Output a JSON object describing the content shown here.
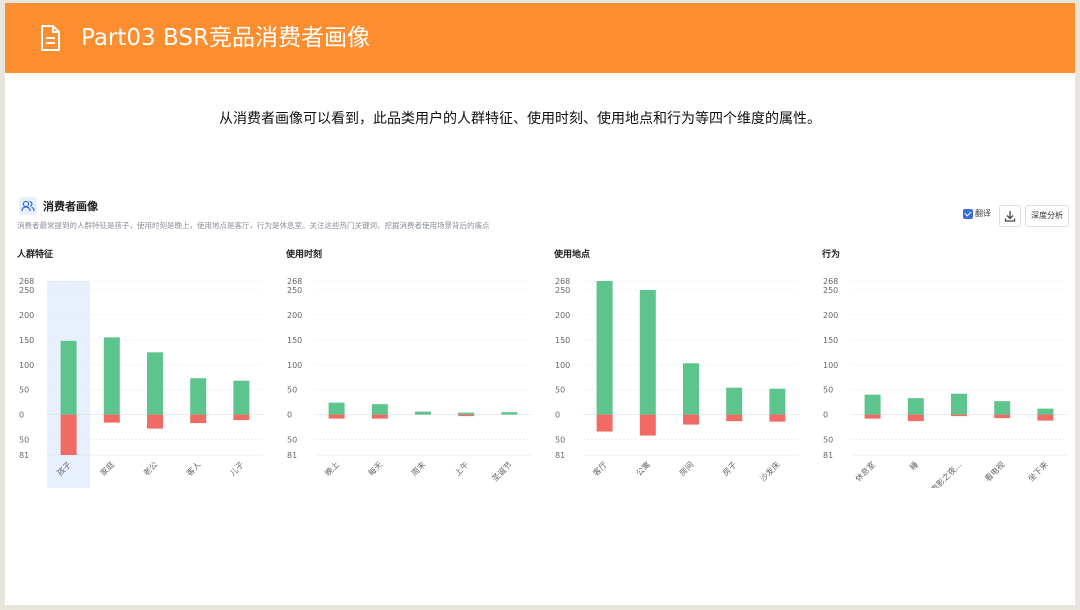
{
  "header": {
    "title": "Part03 BSR竞品消费者画像",
    "icon": "document-icon",
    "bg_color": "#fd8e2f"
  },
  "subtitle": "从消费者画像可以看到，此品类用户的人群特征、使用时刻、使用地点和行为等四个维度的属性。",
  "card": {
    "title": "消费者画像",
    "description": "消费者最常提到的人群特征是孩子，使用时刻是晚上，使用地点是客厅，行为是休息室。关注这些热门关键词，挖掘消费者使用场景背后的痛点",
    "toolbar": {
      "translate_label": "翻译",
      "translate_checked": true,
      "download_icon": "download-icon",
      "deep_analysis_label": "深度分析"
    }
  },
  "colors": {
    "positive": "#5ec48e",
    "negative": "#f06b63",
    "highlight": "#e8f0fd",
    "grid": "#e9ecf1",
    "axis_text": "#666666"
  },
  "chart_data": [
    {
      "type": "bar",
      "title": "人群特征",
      "categories": [
        "孩子",
        "家庭",
        "老公",
        "客人",
        "儿子"
      ],
      "series": [
        {
          "values": [
            148,
            155,
            125,
            73,
            68
          ]
        },
        {
          "values": [
            -81,
            -16,
            -28,
            -17,
            -11
          ]
        }
      ],
      "ylim": [
        -81,
        268
      ],
      "yticks_pos": [
        "268",
        "250",
        "200",
        "150",
        "100",
        "50",
        "0"
      ],
      "yticks_neg": [
        "50",
        "81"
      ],
      "highlighted_category": "孩子"
    },
    {
      "type": "bar",
      "title": "使用时刻",
      "categories": [
        "晚上",
        "每天",
        "周末",
        "上午",
        "圣诞节"
      ],
      "series": [
        {
          "values": [
            24,
            21,
            6,
            4,
            5
          ]
        },
        {
          "values": [
            -8,
            -8,
            0,
            -3,
            0
          ]
        }
      ],
      "ylim": [
        -81,
        268
      ],
      "yticks_pos": [
        "268",
        "250",
        "200",
        "150",
        "100",
        "50",
        "0"
      ],
      "yticks_neg": [
        "50",
        "81"
      ]
    },
    {
      "type": "bar",
      "title": "使用地点",
      "categories": [
        "客厅",
        "公寓",
        "房间",
        "房子",
        "沙发床"
      ],
      "series": [
        {
          "values": [
            268,
            250,
            103,
            54,
            52
          ]
        },
        {
          "values": [
            -34,
            -42,
            -20,
            -13,
            -14
          ]
        }
      ],
      "ylim": [
        -81,
        268
      ],
      "yticks_pos": [
        "268",
        "250",
        "200",
        "150",
        "100",
        "50",
        "0"
      ],
      "yticks_neg": [
        "50",
        "81"
      ]
    },
    {
      "type": "bar",
      "title": "行为",
      "categories": [
        "休息室",
        "睡",
        "电影之夜...",
        "看电视",
        "坐下来"
      ],
      "series": [
        {
          "values": [
            40,
            33,
            42,
            27,
            12
          ]
        },
        {
          "values": [
            -8,
            -13,
            -3,
            -7,
            -12
          ]
        }
      ],
      "ylim": [
        -81,
        268
      ],
      "yticks_pos": [
        "268",
        "250",
        "200",
        "150",
        "100",
        "50",
        "0"
      ],
      "yticks_neg": [
        "50",
        "81"
      ]
    }
  ]
}
